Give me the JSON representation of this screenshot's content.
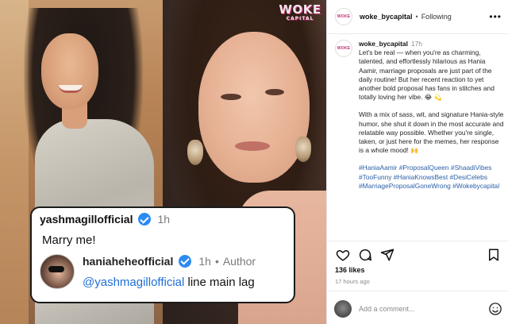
{
  "media": {
    "logo_main": "WOKE",
    "logo_sub": "CAPITAL",
    "comment": {
      "username": "yashmagillofficial",
      "time": "1h",
      "text": "Marry me!"
    },
    "reply": {
      "username": "haniaheheofficial",
      "time": "1h",
      "separator": "•",
      "role": "Author",
      "mention": "@yashmagillofficial",
      "text": " line main lag"
    }
  },
  "header": {
    "avatar_label": "WOKE",
    "username": "woke_bycapital",
    "separator": "•",
    "status": "Following",
    "more_icon": "more-horizontal-icon"
  },
  "caption": {
    "username": "woke_bycapital",
    "time": "17h",
    "paragraph1": "Let's be real — when you're as charming, talented, and effortlessly hilarious as Hania Aamir, marriage proposals are just part of the daily routine! But her recent reaction to yet another bold proposal has fans in stitches and totally loving her vibe.",
    "paragraph1_emoji": "😂 💫",
    "paragraph2": "With a mix of sass, wit, and signature Hania-style humor, she shut it down in the most accurate and relatable way possible. Whether you're single, taken, or just here for the memes, her response is a whole mood!",
    "paragraph2_emoji": "🙌",
    "hashtags": "#HaniaAamir #ProposalQueen #ShaadiVibes #TooFunny #HaniaKnowsBest #DesiCelebs #MarriageProposalGoneWrong #Wokebycapital"
  },
  "actions": {
    "like_icon": "heart-icon",
    "comment_icon": "comment-icon",
    "share_icon": "send-icon",
    "save_icon": "bookmark-icon"
  },
  "likes": "136 likes",
  "posted": "17 hours ago",
  "add_comment": {
    "placeholder": "Add a comment..."
  },
  "colors": {
    "verified": "#2b8bf2",
    "mention": "#1f6fd6",
    "hashtag": "#2b5fa8",
    "logo_accent": "#c0306e"
  }
}
